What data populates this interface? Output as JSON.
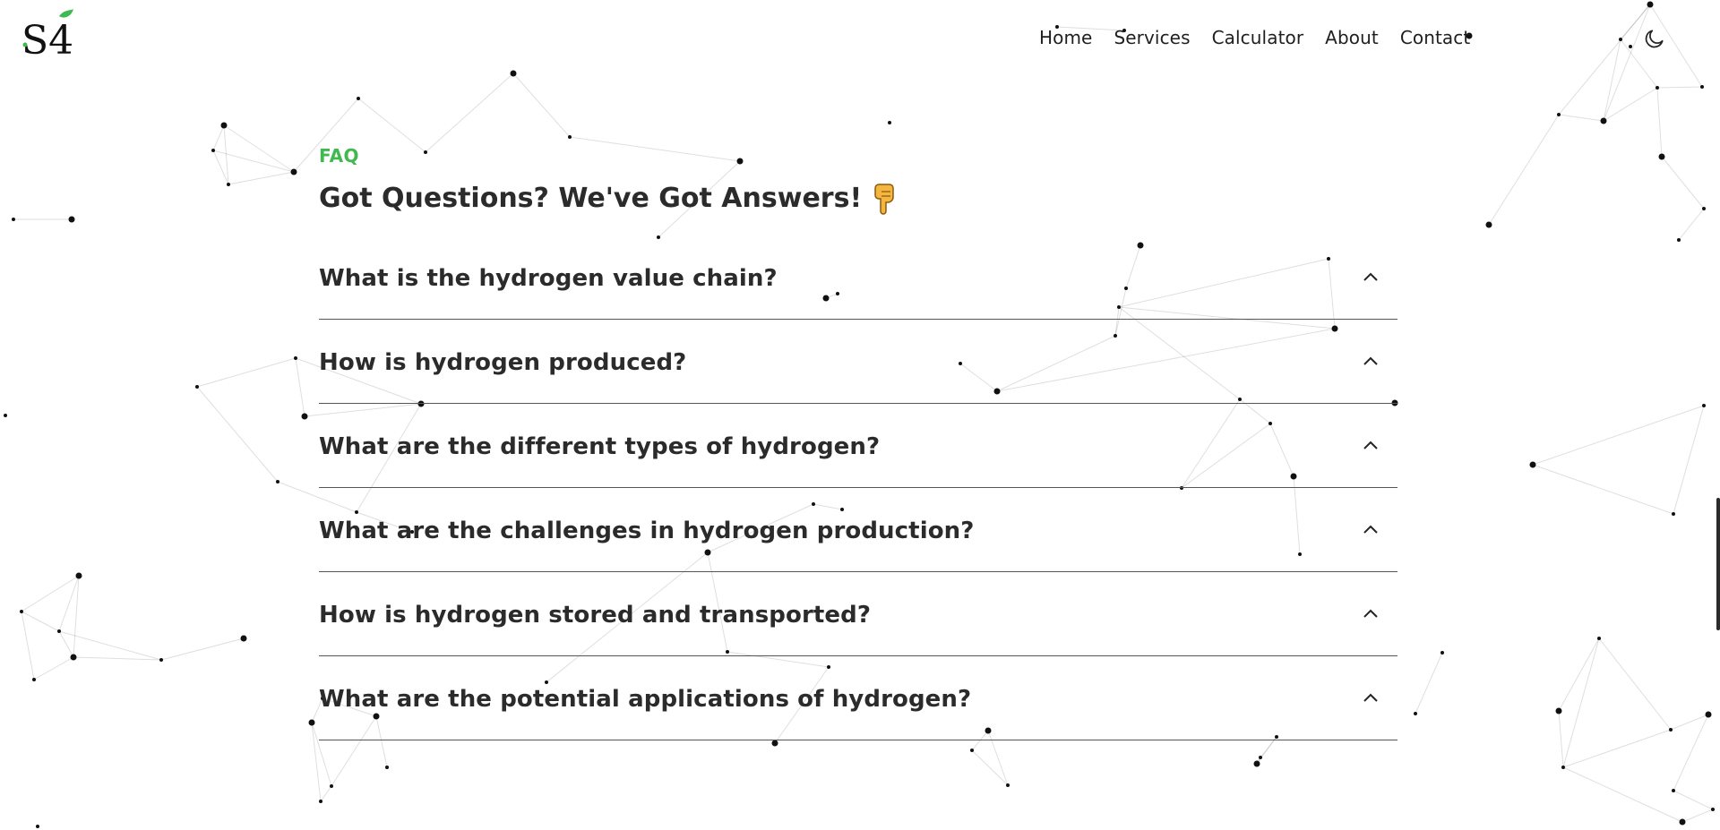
{
  "header": {
    "logo_text": "S4",
    "nav": [
      "Home",
      "Services",
      "Calculator",
      "About",
      "Contact"
    ],
    "theme_toggle_icon": "moon-icon"
  },
  "faq": {
    "eyebrow": "FAQ",
    "title": "Got Questions? We've Got Answers!",
    "title_emoji_icon": "pointing-down-hand-icon",
    "items": [
      {
        "question": "What is the hydrogen value chain?",
        "icon": "chevron-up-icon"
      },
      {
        "question": "How is hydrogen produced?",
        "icon": "chevron-up-icon"
      },
      {
        "question": "What are the different types of hydrogen?",
        "icon": "chevron-up-icon"
      },
      {
        "question": "What are the challenges in hydrogen production?",
        "icon": "chevron-up-icon"
      },
      {
        "question": "How is hydrogen stored and transported?",
        "icon": "chevron-up-icon"
      },
      {
        "question": "What are the potential applications of hydrogen?",
        "icon": "chevron-up-icon"
      }
    ]
  },
  "colors": {
    "accent": "#3fb950",
    "text": "#2b2b2b",
    "divider": "#555555",
    "background": "#ffffff"
  }
}
